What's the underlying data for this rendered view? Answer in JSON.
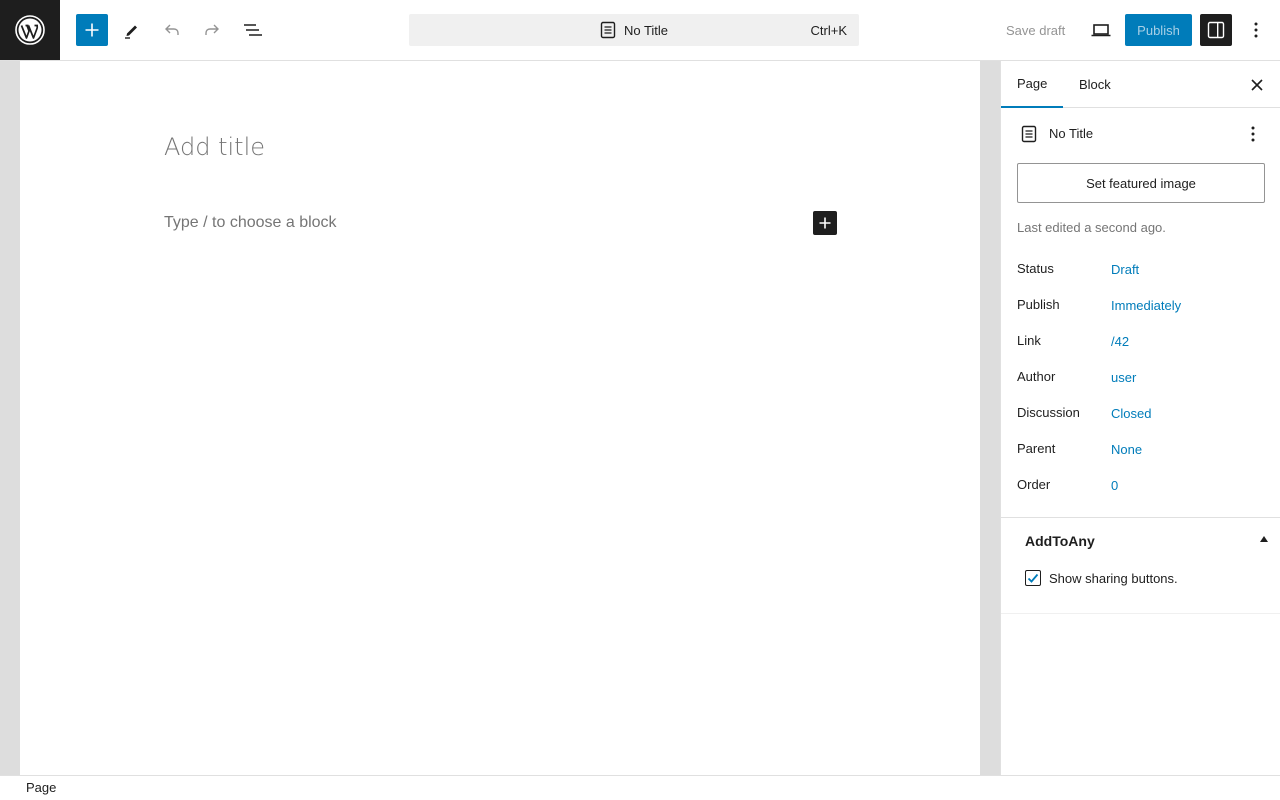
{
  "header": {
    "logo_icon": "wordpress-logo-icon",
    "add_block_icon": "plus-icon",
    "tools_icon": "pencil-icon",
    "undo_icon": "undo-icon",
    "redo_icon": "redo-icon",
    "list_view_icon": "list-view-icon",
    "command_bar": {
      "doc_icon": "page-icon",
      "title": "No Title",
      "shortcut": "Ctrl+K"
    },
    "save_draft": "Save draft",
    "preview_icon": "laptop-icon",
    "publish": "Publish",
    "settings_icon": "sidebar-icon",
    "options_icon": "more-vertical-icon",
    "accent_color": "#007cba"
  },
  "editor": {
    "title_placeholder": "Add title",
    "block_placeholder": "Type / to choose a block",
    "inline_add_icon": "plus-icon"
  },
  "sidebar": {
    "tabs": [
      {
        "label": "Page",
        "active": true
      },
      {
        "label": "Block",
        "active": false
      }
    ],
    "close_icon": "close-icon",
    "document": {
      "icon": "page-icon",
      "title": "No Title",
      "more_icon": "more-vertical-icon"
    },
    "featured_image": "Set featured image",
    "last_edited": "Last edited a second ago.",
    "meta": [
      {
        "key": "Status",
        "value": "Draft"
      },
      {
        "key": "Publish",
        "value": "Immediately"
      },
      {
        "key": "Link",
        "value": "/42"
      },
      {
        "key": "Author",
        "value": "user"
      },
      {
        "key": "Discussion",
        "value": "Closed"
      },
      {
        "key": "Parent",
        "value": "None"
      },
      {
        "key": "Order",
        "value": "0"
      }
    ],
    "addtoany": {
      "title": "AddToAny",
      "checkbox_label": "Show sharing buttons.",
      "checked": true
    }
  },
  "footer": {
    "breadcrumb": "Page"
  }
}
